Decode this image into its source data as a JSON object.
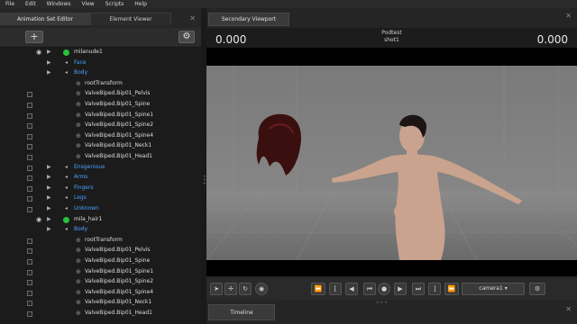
{
  "menu": [
    "File",
    "Edit",
    "Windows",
    "View",
    "Scripts",
    "Help"
  ],
  "left_panel": {
    "tabs": [
      "Animation Set Editor",
      "Element Viewer"
    ],
    "add_label": "+",
    "gear_label": "⚙"
  },
  "tree": [
    {
      "label": "milanude1",
      "color": "white",
      "indent": 82,
      "eye": true,
      "ball": true
    },
    {
      "label": "Face",
      "color": "blue",
      "indent": 82
    },
    {
      "label": "Body",
      "color": "blue",
      "indent": 82
    },
    {
      "label": "rootTransform",
      "color": "white",
      "indent": 94,
      "node": true
    },
    {
      "label": "ValveBiped.Bip01_Pelvis",
      "color": "white",
      "indent": 94,
      "node": true,
      "cb": true
    },
    {
      "label": "ValveBiped.Bip01_Spine",
      "color": "white",
      "indent": 94,
      "node": true,
      "cb": true
    },
    {
      "label": "ValveBiped.Bip01_Spine1",
      "color": "white",
      "indent": 94,
      "node": true,
      "cb": true
    },
    {
      "label": "ValveBiped.Bip01_Spine2",
      "color": "white",
      "indent": 94,
      "node": true,
      "cb": true
    },
    {
      "label": "ValveBiped.Bip01_Spine4",
      "color": "white",
      "indent": 94,
      "node": true,
      "cb": true
    },
    {
      "label": "ValveBiped.Bip01_Neck1",
      "color": "white",
      "indent": 94,
      "node": true,
      "cb": true
    },
    {
      "label": "ValveBiped.Bip01_Head1",
      "color": "white",
      "indent": 94,
      "node": true,
      "cb": true
    },
    {
      "label": "Ensgenious",
      "color": "blue",
      "indent": 82,
      "cb": true
    },
    {
      "label": "Arms",
      "color": "blue",
      "indent": 82,
      "cb": true
    },
    {
      "label": "Fingers",
      "color": "blue",
      "indent": 82,
      "cb": true
    },
    {
      "label": "Legs",
      "color": "blue",
      "indent": 82,
      "cb": true
    },
    {
      "label": "Unknown",
      "color": "blue",
      "indent": 82,
      "cb": true
    },
    {
      "label": "mila_hair1",
      "color": "white",
      "indent": 82,
      "eye": true,
      "ball": true
    },
    {
      "label": "Body",
      "color": "blue",
      "indent": 82
    },
    {
      "label": "rootTransform",
      "color": "white",
      "indent": 94,
      "node": true,
      "cb": true
    },
    {
      "label": "ValveBiped.Bip01_Pelvis",
      "color": "white",
      "indent": 94,
      "node": true,
      "cb": true
    },
    {
      "label": "ValveBiped.Bip01_Spine",
      "color": "white",
      "indent": 94,
      "node": true,
      "cb": true
    },
    {
      "label": "ValveBiped.Bip01_Spine1",
      "color": "white",
      "indent": 94,
      "node": true,
      "cb": true
    },
    {
      "label": "ValveBiped.Bip01_Spine2",
      "color": "white",
      "indent": 94,
      "node": true,
      "cb": true
    },
    {
      "label": "ValveBiped.Bip01_Spine4",
      "color": "white",
      "indent": 94,
      "node": true,
      "cb": true
    },
    {
      "label": "ValveBiped.Bip01_Neck1",
      "color": "white",
      "indent": 94,
      "node": true,
      "cb": true
    },
    {
      "label": "ValveBiped.Bip01_Head1",
      "color": "white",
      "indent": 94,
      "node": true,
      "cb": true
    }
  ],
  "viewport": {
    "tab_label": "Secondary Viewport",
    "time_left": "0.000",
    "time_right": "0.000",
    "title_line1": "Podtest",
    "title_line2": "shot1"
  },
  "controls": {
    "camera_label": "camera1"
  },
  "timeline_tab": "Timeline",
  "colors": {
    "accent_blue": "#4aa3ff",
    "green": "#27c23a"
  }
}
